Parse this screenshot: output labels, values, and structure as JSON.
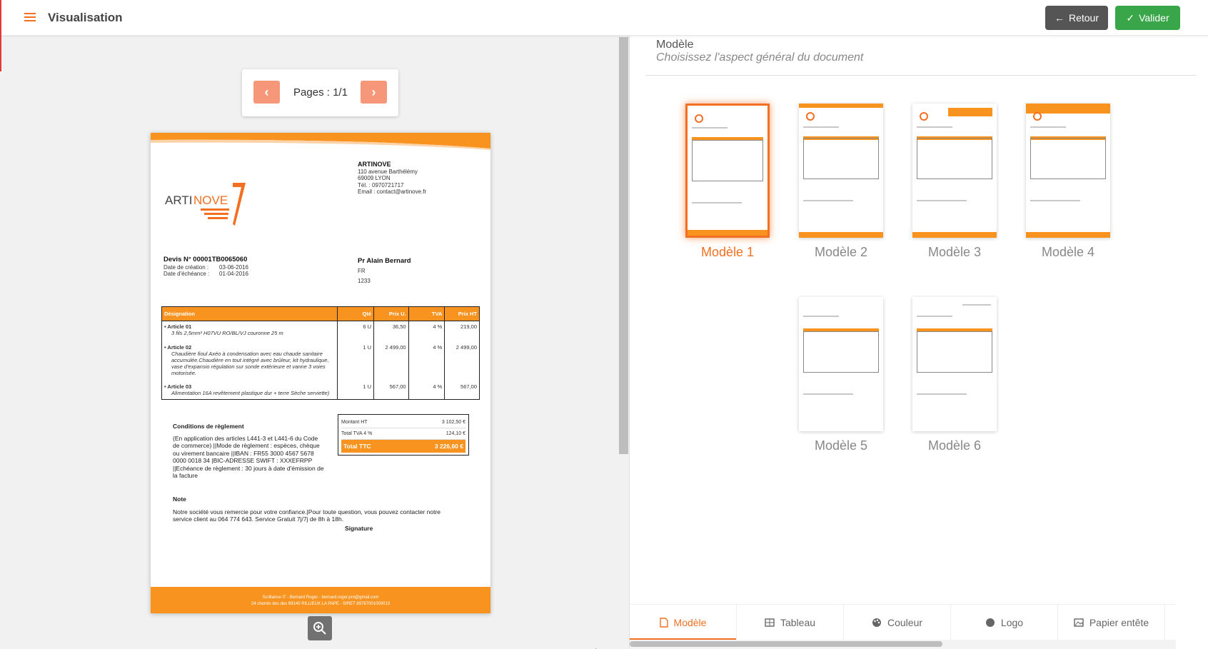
{
  "header": {
    "title": "Visualisation",
    "retour_label": "Retour",
    "valider_label": "Valider",
    "accent_color": "#f36f21"
  },
  "pager": {
    "label": "Pages : 1/1",
    "prev_icon": "chevron-left-icon",
    "next_icon": "chevron-right-icon"
  },
  "document": {
    "logo_text": {
      "part1": "ARTI",
      "part2": "NOVE"
    },
    "company": {
      "name": "ARTINOVE",
      "address": "110 avenue Barthélémy",
      "city": "69009 LYON",
      "phone": "Tél. :  0970721717",
      "email": "Email :  contact@artinove.fr"
    },
    "devis": {
      "number": "Devis N° 00001TB0065060",
      "creation_label": "Date de création :",
      "creation_value": "03-06-2016",
      "echeance_label": "Date d'échéance :",
      "echeance_value": "01-04-2016"
    },
    "client": {
      "name": "Pr Alain Bernard",
      "country": "FR",
      "code": "1233"
    },
    "table": {
      "headers": [
        "Désignation",
        "Qté",
        "Prix U.",
        "TVA",
        "Prix HT"
      ],
      "rows": [
        {
          "name": "• Article 01",
          "desc": "3 fils 2,5mm² H07VU RO/BL/VJ couronne 25 m",
          "qty": "6 U",
          "price": "36,50",
          "tva": "4 %",
          "total": "219,00"
        },
        {
          "name": "• Article 02",
          "desc": "Chaudière fioul Axéo à condensation avec eau chaude sanitaire accumulée.Chaudière en tout intégré avec brûleur, kit hydraulique, vase d'expansio régulation sur sonde extérieure et vanne 3 voies motorisée.",
          "qty": "1 U",
          "price": "2 499,00",
          "tva": "4 %",
          "total": "2 499,00"
        },
        {
          "name": "• Article 03",
          "desc": "Alimentation 16A revêtement plastique dur + terre Sèche serviette)",
          "qty": "1 U",
          "price": "567,00",
          "tva": "4 %",
          "total": "567,00"
        }
      ]
    },
    "conditions": {
      "title": "Conditions de règlement",
      "text": "(En application des articles L441-3 et L441-6 du Code de commerce) ||Mode de règlement : espèces, chèque ou virement bancaire ||IBAN : FR55 3000 4567 5678 0000 0018 34 |BIC-ADRESSE SWIFT : XXXEFRPP ||Echéance de règlement : 30 jours à date d'émission de la facture"
    },
    "totals": {
      "ht_label": "Montant HT",
      "ht_value": "3 102,50 €",
      "tva_label": "Total TVA 4 %",
      "tva_value": "124,10 €",
      "ttc_label": "Total TTC",
      "ttc_value": "3 226,60 €"
    },
    "note": {
      "title": "Note",
      "text": "Notre société vous remercie pour votre confiance.|Pour toute question, vous pouvez contacter notre service client au 064 774 643. Service Gratuit 7j/7j de 8h à 18h."
    },
    "signature": "Signature",
    "footer": {
      "line1": "Scrillance IT - Bernard Roger - bernard.roger.pro@gmail.com",
      "line2": "24 chemin des des 69140 RILLIEUX LA PAPE - SIRET 89787001000013"
    }
  },
  "right_panel": {
    "title": "Modèle",
    "subtitle": "Choisissez l'aspect général du document",
    "models": [
      {
        "label": "Modèle 1",
        "selected": true
      },
      {
        "label": "Modèle 2",
        "selected": false
      },
      {
        "label": "Modèle 3",
        "selected": false
      },
      {
        "label": "Modèle 4",
        "selected": false
      },
      {
        "label": "Modèle 5",
        "selected": false
      },
      {
        "label": "Modèle 6",
        "selected": false
      }
    ]
  },
  "tabs": [
    {
      "label": "Modèle",
      "icon": "file-icon",
      "active": true
    },
    {
      "label": "Tableau",
      "icon": "table-icon",
      "active": false
    },
    {
      "label": "Couleur",
      "icon": "palette-icon",
      "active": false
    },
    {
      "label": "Logo",
      "icon": "circle-icon",
      "active": false
    },
    {
      "label": "Papier entête",
      "icon": "image-icon",
      "active": false
    }
  ]
}
